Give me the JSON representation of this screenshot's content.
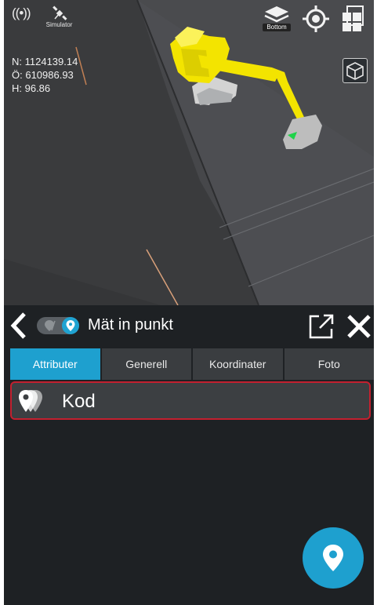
{
  "viewport": {
    "gps_icon": "gps-signal-icon",
    "satellite_icon": "satellite-icon",
    "simulator_label": "Simulator",
    "coords": {
      "north": "N: 1124139.14",
      "east": "Ö: 610986.93",
      "height": "H: 96.86"
    },
    "layers_label": "Bottom",
    "icons": [
      "layers-icon",
      "crosshair-target-icon",
      "windows-icon",
      "view-cube-icon"
    ]
  },
  "panel": {
    "title": "Mät in punkt",
    "tabs": [
      {
        "label": "Attributer",
        "active": true
      },
      {
        "label": "Generell",
        "active": false
      },
      {
        "label": "Koordinater",
        "active": false
      },
      {
        "label": "Foto",
        "active": false
      }
    ],
    "kod_label": "Kod"
  },
  "colors": {
    "accent": "#1ea0cf",
    "highlight_border": "#c3202f",
    "machine": "#f3e400"
  }
}
